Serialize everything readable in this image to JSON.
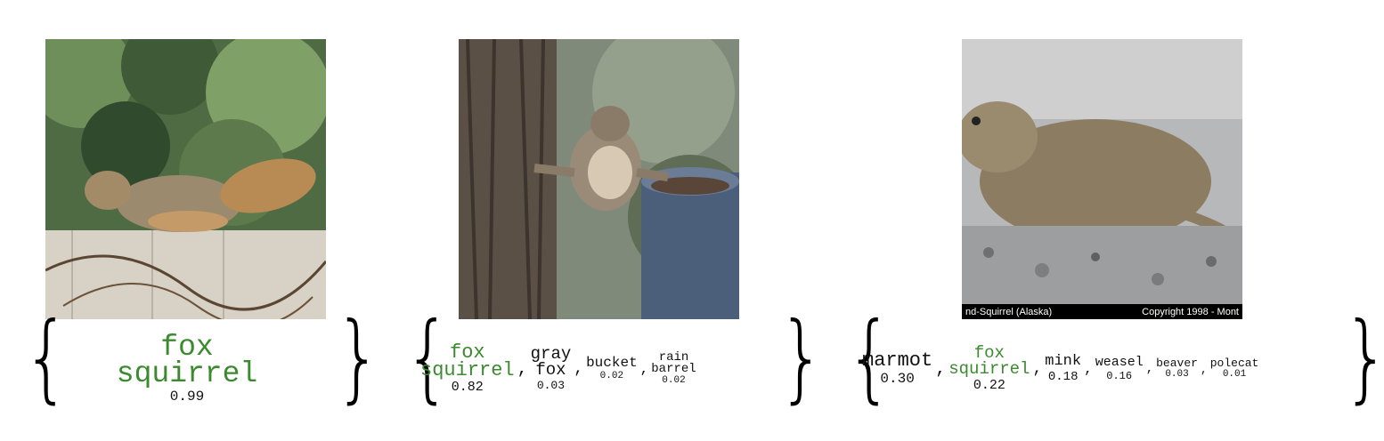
{
  "colors": {
    "correct_label": "#3b8a2f",
    "default_label": "#111111"
  },
  "panels": [
    {
      "image_description": "fox squirrel on fence",
      "predictions": [
        {
          "label": "fox\nsquirrel",
          "score": "0.99",
          "highlight": true
        }
      ]
    },
    {
      "image_description": "squirrel on tree next to barrel",
      "predictions": [
        {
          "label": "fox\nsquirrel",
          "score": "0.82",
          "highlight": true
        },
        {
          "label": "gray\nfox",
          "score": "0.03",
          "highlight": false
        },
        {
          "label": "bucket",
          "score": "0.02",
          "highlight": false
        },
        {
          "label": "rain\nbarrel",
          "score": "0.02",
          "highlight": false
        }
      ]
    },
    {
      "image_description": "ground squirrel on gravel",
      "caption_left": "nd-Squirrel (Alaska)",
      "caption_right": "Copyright 1998 - Mont",
      "predictions": [
        {
          "label": "marmot",
          "score": "0.30",
          "highlight": false
        },
        {
          "label": "fox\nsquirrel",
          "score": "0.22",
          "highlight": true
        },
        {
          "label": "mink",
          "score": "0.18",
          "highlight": false
        },
        {
          "label": "weasel",
          "score": "0.16",
          "highlight": false
        },
        {
          "label": "beaver",
          "score": "0.03",
          "highlight": false
        },
        {
          "label": "polecat",
          "score": "0.01",
          "highlight": false
        }
      ]
    }
  ]
}
